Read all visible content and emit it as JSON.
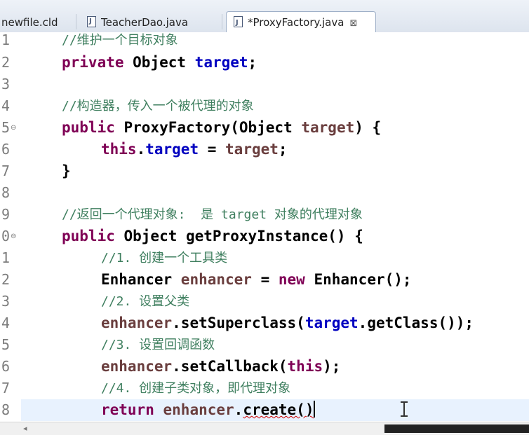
{
  "tabs": [
    {
      "label": "newfile.cld",
      "active": false
    },
    {
      "label": "TeacherDao.java",
      "active": false
    },
    {
      "label": "*ProxyFactory.java",
      "active": true,
      "close": "⊠"
    }
  ],
  "editor": {
    "current_line": 18,
    "lines": [
      {
        "n": "1",
        "text": "//维护一个目标对象"
      },
      {
        "n": "2",
        "text": "private Object target;"
      },
      {
        "n": "3",
        "text": ""
      },
      {
        "n": "4",
        "text": "//构造器，传入一个被代理的对象"
      },
      {
        "n": "5",
        "text": "public ProxyFactory(Object target) {",
        "fold": true
      },
      {
        "n": "6",
        "text": "this.target = target;"
      },
      {
        "n": "7",
        "text": "}"
      },
      {
        "n": "8",
        "text": ""
      },
      {
        "n": "9",
        "text": "//返回一个代理对象:  是 target 对象的代理对象"
      },
      {
        "n": "0",
        "text": "public Object getProxyInstance() {",
        "fold": true
      },
      {
        "n": "1",
        "text": "//1. 创建一个工具类"
      },
      {
        "n": "2",
        "text": "Enhancer enhancer = new Enhancer();"
      },
      {
        "n": "3",
        "text": "//2. 设置父类"
      },
      {
        "n": "4",
        "text": "enhancer.setSuperclass(target.getClass());"
      },
      {
        "n": "5",
        "text": "//3. 设置回调函数"
      },
      {
        "n": "6",
        "text": "enhancer.setCallback(this);"
      },
      {
        "n": "7",
        "text": "//4. 创建子类对象，即代理对象"
      },
      {
        "n": "8",
        "text": "return enhancer.create()"
      }
    ]
  },
  "colors": {
    "keyword": "#7f0055",
    "field": "#0000c0",
    "local_var": "#6a3e3e",
    "comment": "#3f7f5f",
    "current_line_bg": "#e8f2fe"
  },
  "icons": {
    "tab_file": "java-file-icon",
    "tab_close": "close-icon",
    "fold": "fold-minus-icon",
    "cursor": "text-ibeam-cursor-icon"
  }
}
